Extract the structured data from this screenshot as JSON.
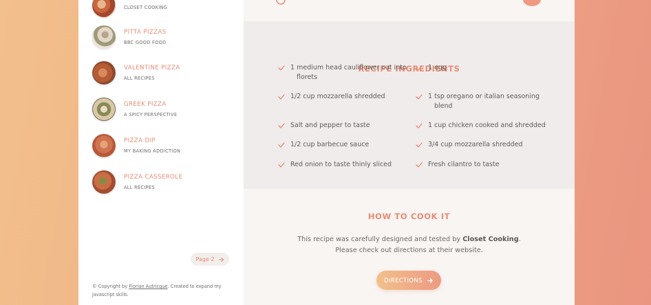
{
  "sidebar": {
    "results": [
      {
        "name": "",
        "source": "CLOSET COOKING"
      },
      {
        "name": "PITTA PIZZAS",
        "source": "BBC GOOD FOOD"
      },
      {
        "name": "VALENTINE PIZZA",
        "source": "ALL RECIPES"
      },
      {
        "name": "GREEK PIZZA",
        "source": "A SPICY PERSPECTIVE"
      },
      {
        "name": "PIZZA DIP",
        "source": "MY BAKING ADDICTION"
      },
      {
        "name": "PIZZA CASSEROLE",
        "source": "ALL RECIPES"
      }
    ],
    "pagination": {
      "next_label": "Page 2",
      "next_icon": "arrow-right-icon"
    },
    "copyright": {
      "prefix": "© Copyright by ",
      "author": "Florian Autricque",
      "suffix": ". Created to expand my Javascript skills."
    }
  },
  "ingredients": {
    "title": "RECIPE INGREDIENTS",
    "items": [
      {
        "line1": "1 medium head cauliflower cut into",
        "line2": "florets"
      },
      {
        "line1": "1 egg",
        "line2": ""
      },
      {
        "line1": "1/2 cup mozzarella shredded",
        "line2": ""
      },
      {
        "line1": "1 tsp oregano or italian seasoning",
        "line2": "blend"
      },
      {
        "line1": " Salt and pepper to taste",
        "line2": ""
      },
      {
        "line1": "1 cup chicken cooked and shredded",
        "line2": ""
      },
      {
        "line1": "1/2 cup barbecue sauce",
        "line2": ""
      },
      {
        "line1": "3/4 cup mozzarella shredded",
        "line2": ""
      },
      {
        "line1": " Red onion to taste thinly sliced",
        "line2": ""
      },
      {
        "line1": " Fresh cilantro to taste",
        "line2": ""
      }
    ]
  },
  "how_to_cook": {
    "title": "HOW TO COOK IT",
    "text_before": "This recipe was carefully designed and tested by ",
    "publisher": "Closet Cooking",
    "text_after": ". Please check out directions at their website.",
    "button_label": "DIRECTIONS",
    "button_icon": "arrow-right-icon"
  },
  "colors": {
    "accent": "#e98b73",
    "gradient_start": "#f2c08c",
    "gradient_end": "#ea9580"
  }
}
